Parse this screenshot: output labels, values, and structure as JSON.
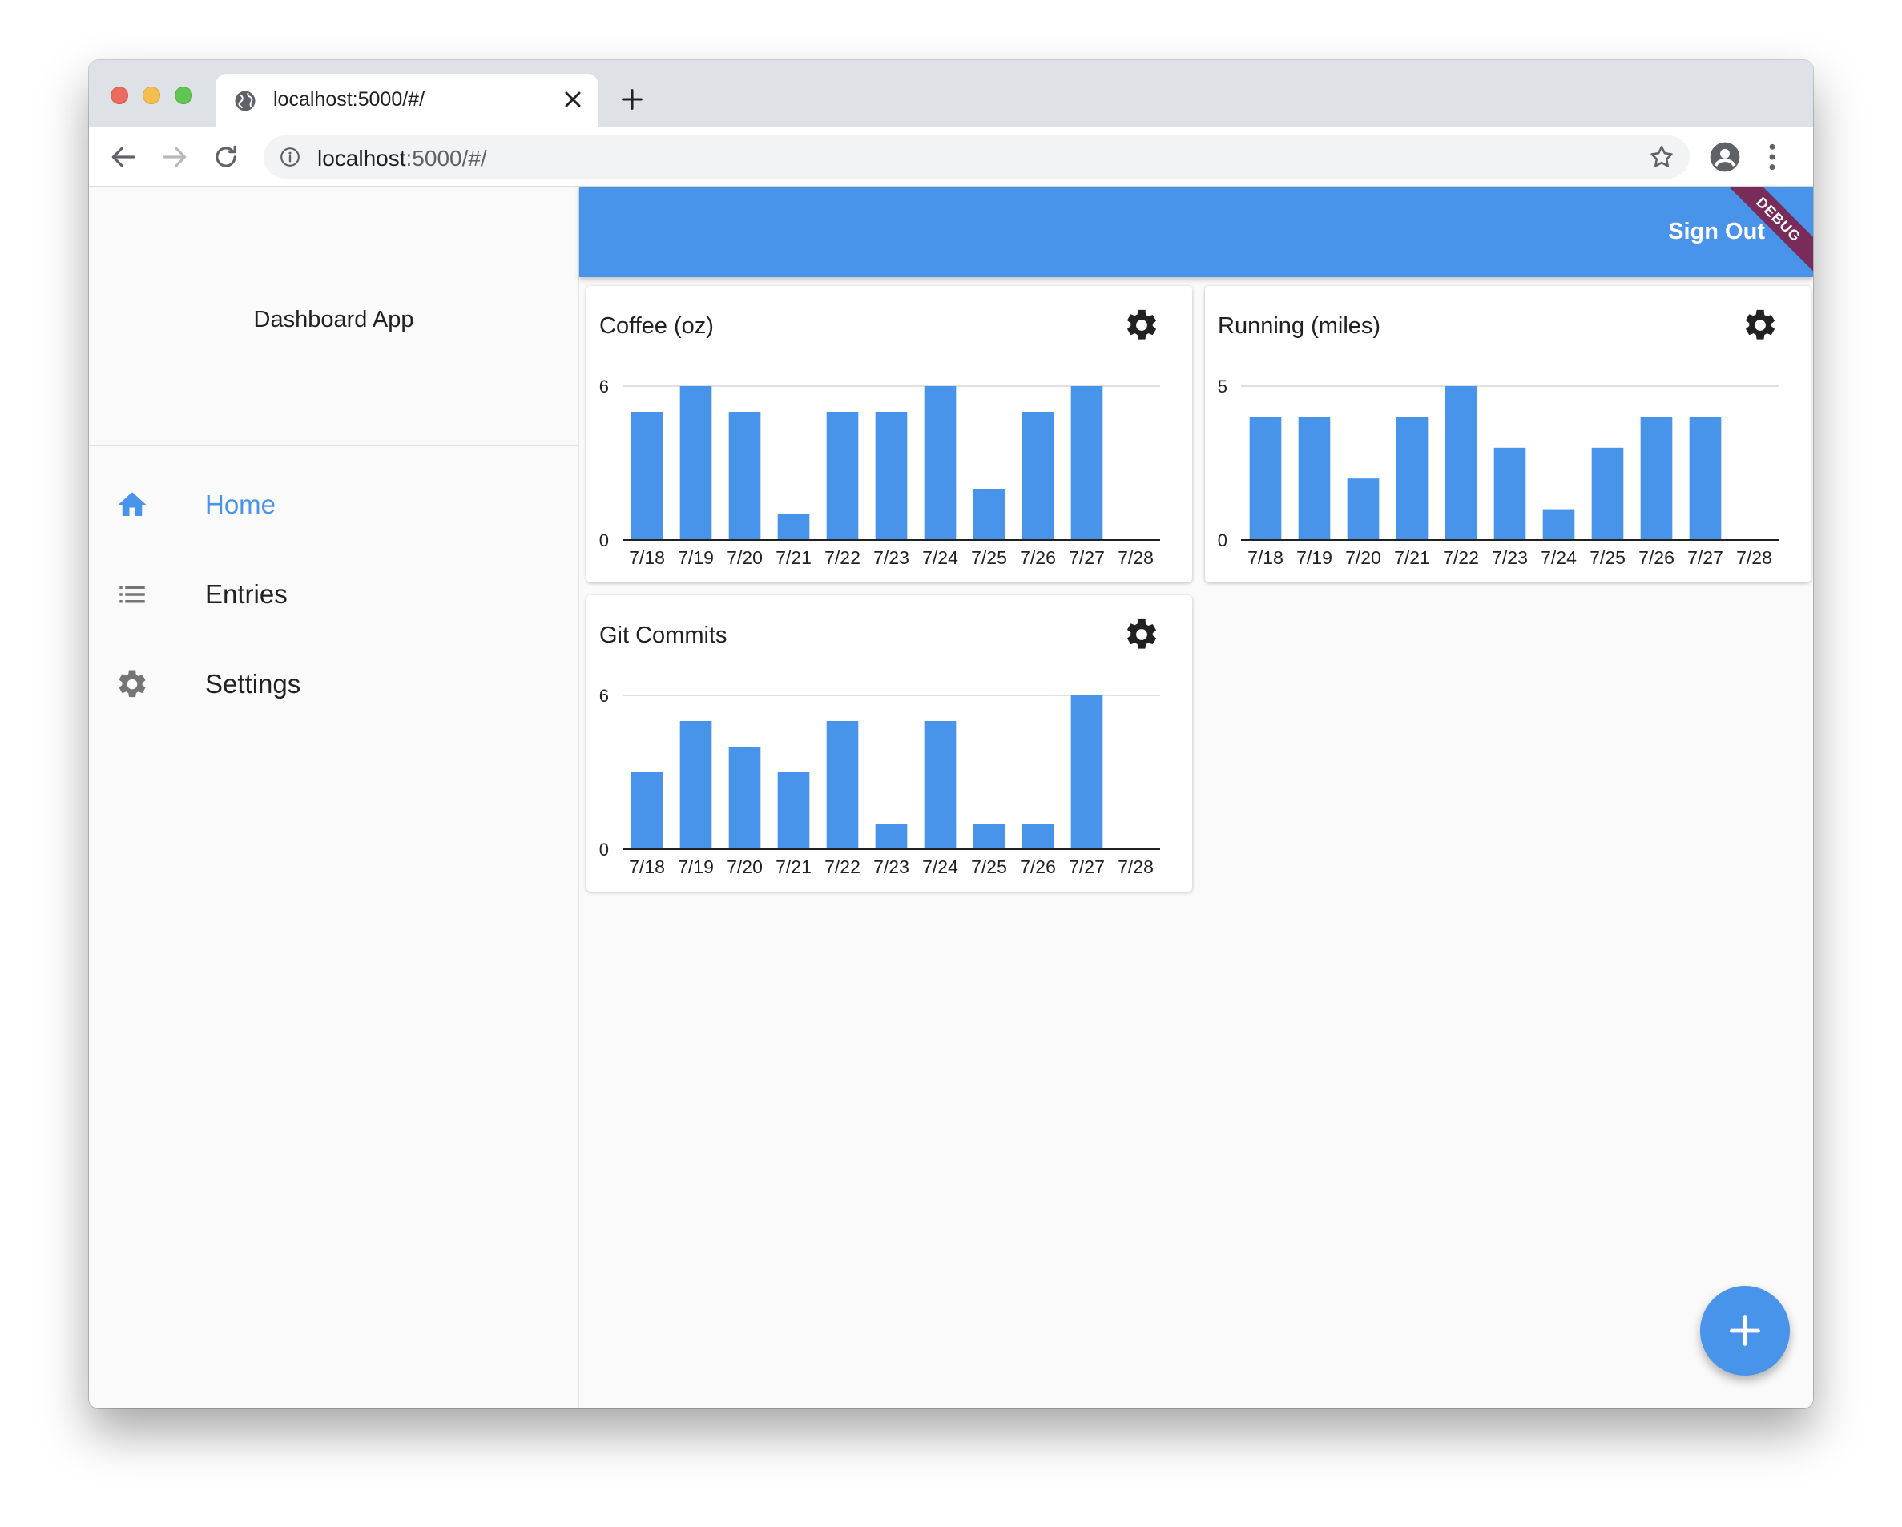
{
  "browser": {
    "tab_title": "localhost:5000/#/",
    "url_host": "localhost",
    "url_rest": ":5000/#/"
  },
  "sidebar": {
    "app_title": "Dashboard App",
    "items": [
      {
        "label": "Home",
        "icon": "home-icon",
        "active": true
      },
      {
        "label": "Entries",
        "icon": "list-icon",
        "active": false
      },
      {
        "label": "Settings",
        "icon": "gear-icon",
        "active": false
      }
    ]
  },
  "appbar": {
    "sign_out_label": "Sign Out",
    "debug_banner": "DEBUG"
  },
  "colors": {
    "accent": "#4794ea",
    "text": "#212121"
  },
  "charts": [
    {
      "title": "Coffee (oz)"
    },
    {
      "title": "Running (miles)"
    },
    {
      "title": "Git Commits"
    }
  ],
  "chart_data": [
    {
      "type": "bar",
      "title": "Coffee (oz)",
      "categories": [
        "7/18",
        "7/19",
        "7/20",
        "7/21",
        "7/22",
        "7/23",
        "7/24",
        "7/25",
        "7/26",
        "7/27",
        "7/28"
      ],
      "values": [
        5,
        6,
        5,
        1,
        5,
        5,
        6,
        2,
        5,
        6,
        0
      ],
      "yticks": [
        "0",
        "6"
      ],
      "ylim": [
        0,
        6
      ],
      "grid": true
    },
    {
      "type": "bar",
      "title": "Running (miles)",
      "categories": [
        "7/18",
        "7/19",
        "7/20",
        "7/21",
        "7/22",
        "7/23",
        "7/24",
        "7/25",
        "7/26",
        "7/27",
        "7/28"
      ],
      "values": [
        4,
        4,
        2,
        4,
        5,
        3,
        1,
        3,
        4,
        4,
        0
      ],
      "yticks": [
        "0",
        "5"
      ],
      "ylim": [
        0,
        5
      ],
      "grid": true
    },
    {
      "type": "bar",
      "title": "Git Commits",
      "categories": [
        "7/18",
        "7/19",
        "7/20",
        "7/21",
        "7/22",
        "7/23",
        "7/24",
        "7/25",
        "7/26",
        "7/27",
        "7/28"
      ],
      "values": [
        3,
        5,
        4,
        3,
        5,
        1,
        5,
        1,
        1,
        6,
        0
      ],
      "yticks": [
        "0",
        "6"
      ],
      "ylim": [
        0,
        6
      ],
      "grid": true
    }
  ]
}
